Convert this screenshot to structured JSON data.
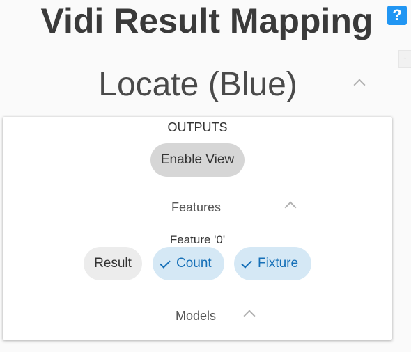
{
  "app": {
    "title": "Vidi Result Mapping",
    "help_label": "?",
    "scroll_top_glyph": "↑"
  },
  "section": {
    "title": "Locate (Blue)",
    "collapse_icon": "chevron-up-icon"
  },
  "outputs": {
    "heading": "OUTPUTS",
    "enable_view_label": "Enable View",
    "features": {
      "label": "Features",
      "collapse_icon": "chevron-up-icon",
      "feature_label": "Feature '0'",
      "chips": [
        {
          "label": "Result",
          "selected": false
        },
        {
          "label": "Count",
          "selected": true
        },
        {
          "label": "Fixture",
          "selected": true
        }
      ]
    },
    "models": {
      "label": "Models",
      "collapse_icon": "chevron-up-icon"
    }
  },
  "colors": {
    "background": "#fafafa",
    "help_button": "#2196f3",
    "chip_selected_bg": "#d5e8f5",
    "chip_selected_text": "#1670b8",
    "chip_unselected_bg": "#ececec",
    "button_bg": "#d6d6d6"
  }
}
